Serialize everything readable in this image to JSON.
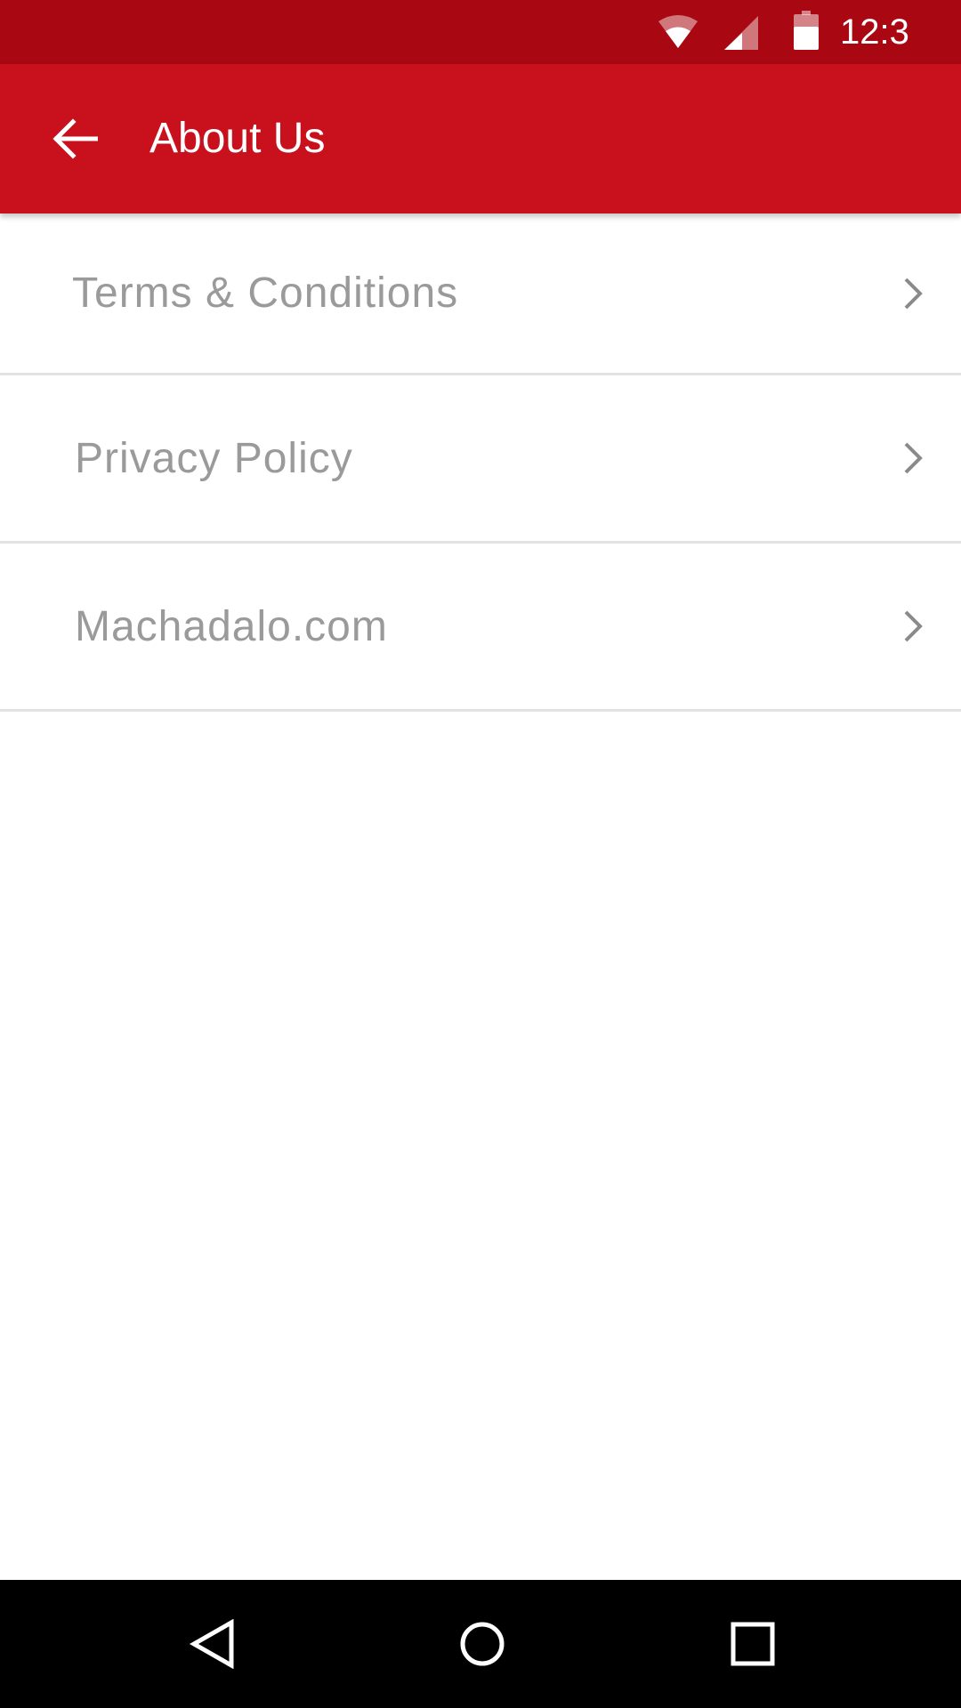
{
  "status_bar": {
    "time": "12:3",
    "icons": [
      "wifi-icon",
      "signal-icon",
      "battery-icon"
    ]
  },
  "app_bar": {
    "title": "About Us",
    "back_icon": "arrow-back-icon"
  },
  "list": {
    "items": [
      {
        "label": "Terms & Conditions",
        "icon": "chevron-right-icon"
      },
      {
        "label": "Privacy Policy",
        "icon": "chevron-right-icon"
      },
      {
        "label": "Machadalo.com",
        "icon": "chevron-right-icon"
      }
    ]
  },
  "nav_bar": {
    "icons": [
      "nav-back-icon",
      "nav-home-icon",
      "nav-recents-icon"
    ]
  },
  "colors": {
    "status_bar": "#a90812",
    "app_bar": "#c8111c",
    "list_text": "#9a9a9a",
    "divider": "#e3e3e3",
    "nav_bar": "#000000"
  }
}
